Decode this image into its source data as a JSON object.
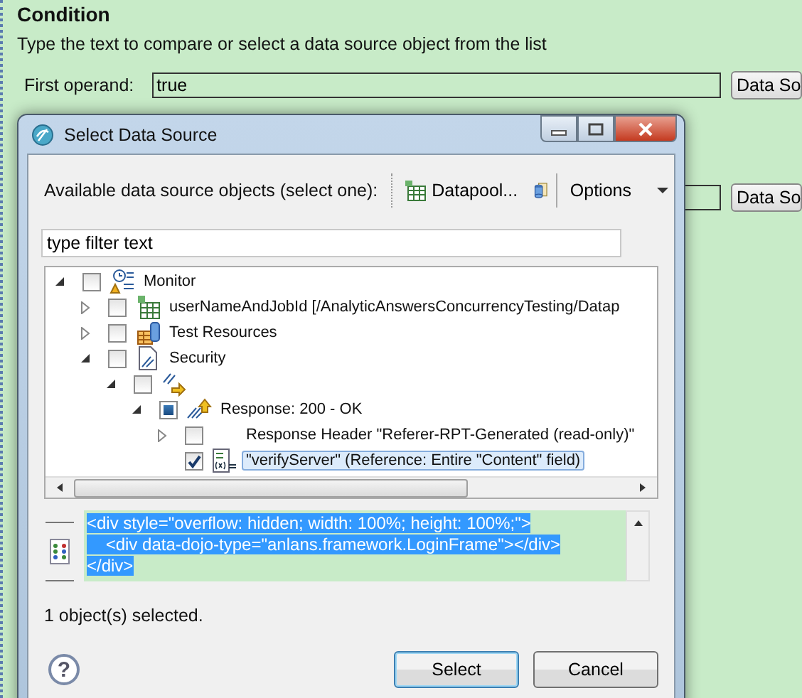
{
  "section": {
    "title": "Condition",
    "instruction": "Type the text to compare or select a data source object from the list",
    "operands": [
      {
        "label": "First operand:",
        "value": "true",
        "button": "Data So"
      },
      {
        "button": "Data So"
      }
    ]
  },
  "dialog": {
    "title": "Select Data Source",
    "toolbar": {
      "label": "Available data source objects (select one):",
      "datapool": "Datapool...",
      "options": "Options"
    },
    "filter": {
      "value": "type filter text"
    },
    "tree": [
      {
        "label": "Monitor",
        "kind": "monitor",
        "checked": false,
        "expandable": true,
        "expanded": true,
        "selected": false,
        "children": [
          {
            "label": "userNameAndJobId [/AnalyticAnswersConcurrencyTesting/Datap",
            "kind": "datapool",
            "checked": false,
            "expandable": true,
            "expanded": false,
            "selected": false
          },
          {
            "label": "Test Resources",
            "kind": "resources",
            "checked": false,
            "expandable": true,
            "expanded": false,
            "selected": false
          },
          {
            "label": "Security",
            "kind": "security",
            "checked": false,
            "expandable": true,
            "expanded": true,
            "selected": false,
            "children": [
              {
                "kind": "page",
                "checked": false,
                "expandable": true,
                "expanded": true,
                "selected": false,
                "children": [
                  {
                    "label": "Response: 200 - OK",
                    "kind": "response",
                    "checked": false,
                    "partial": true,
                    "expandable": true,
                    "expanded": true,
                    "selected": false,
                    "children": [
                      {
                        "label": "Response Header \"Referer-RPT-Generated (read-only)\"",
                        "kind": "plain",
                        "checked": false,
                        "expandable": true,
                        "expanded": false,
                        "selected": false
                      },
                      {
                        "label": "\"verifyServer\" (Reference: Entire \"Content\" field)",
                        "kind": "reference",
                        "checked": true,
                        "expandable": false,
                        "selected": true
                      }
                    ]
                  }
                ]
              }
            ]
          }
        ]
      }
    ],
    "details": {
      "selected": true,
      "lines": [
        "<div style=\"overflow: hidden; width: 100%; height: 100%;\">",
        "    <div data-dojo-type=\"anlans.framework.LoginFrame\"></div>",
        "</div>"
      ]
    },
    "status": "1 object(s) selected.",
    "help": "?",
    "buttons": [
      {
        "label": "Select",
        "focused": true
      },
      {
        "label": "Cancel",
        "focused": false
      }
    ]
  }
}
